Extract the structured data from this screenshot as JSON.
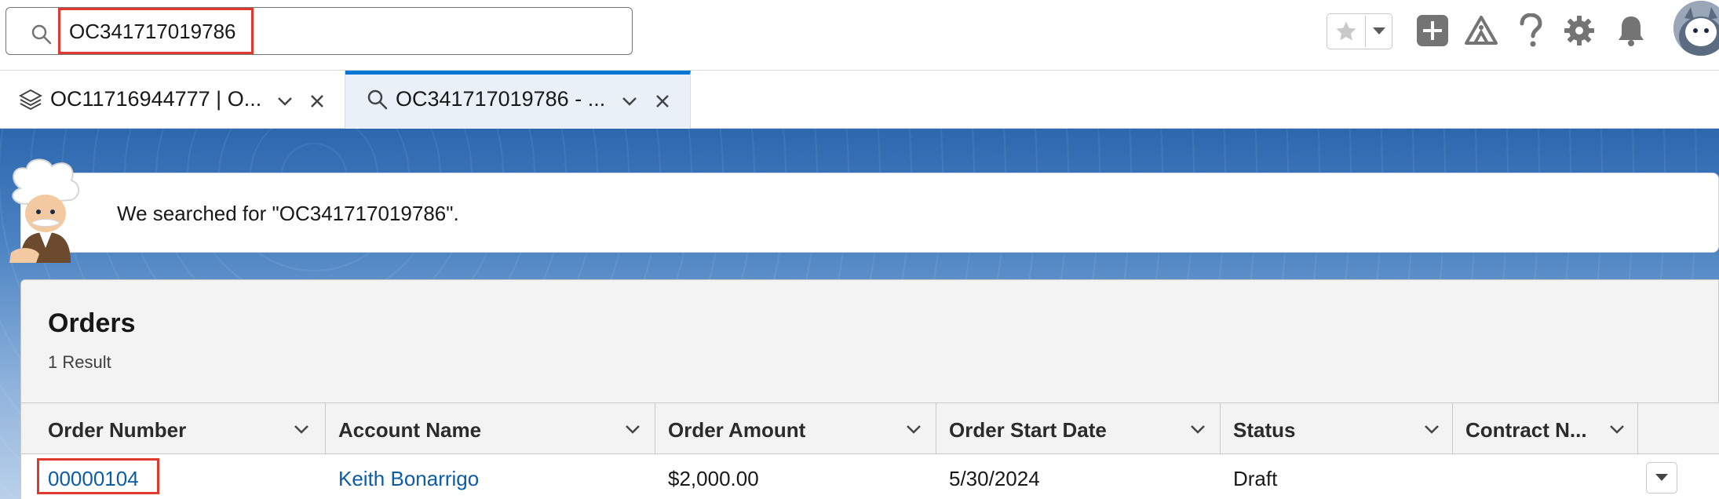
{
  "search": {
    "value": "OC341717019786",
    "placeholder": ""
  },
  "tabs": [
    {
      "label": "OC11716944777 | O..."
    },
    {
      "label": "OC341717019786 - ..."
    }
  ],
  "notice": {
    "text": "We searched for \"OC341717019786\"."
  },
  "results": {
    "title": "Orders",
    "count_label": "1 Result",
    "columns": [
      "Order Number",
      "Account Name",
      "Order Amount",
      "Order Start Date",
      "Status",
      "Contract N..."
    ],
    "rows": [
      {
        "order_number": "00000104",
        "account_name": "Keith Bonarrigo",
        "order_amount": "$2,000.00",
        "order_start_date": "5/30/2024",
        "status": "Draft",
        "contract_number": ""
      }
    ]
  },
  "colors": {
    "accent": "#0176d3",
    "link": "#0b5cab",
    "highlight": "#e03a2f"
  },
  "icons": [
    "search-icon",
    "star-icon",
    "chevron-down-icon",
    "plus-icon",
    "trailhead-icon",
    "help-icon",
    "gear-icon",
    "bell-icon",
    "stack-icon",
    "close-icon"
  ]
}
